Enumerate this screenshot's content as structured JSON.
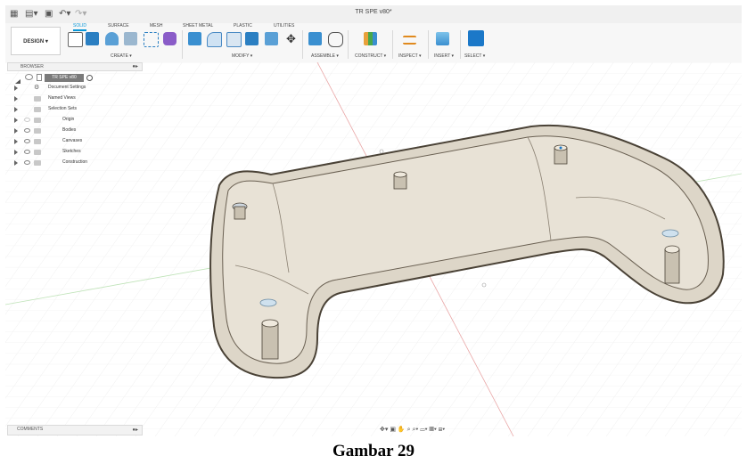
{
  "window": {
    "title": "TR SPE v80*"
  },
  "workspace": {
    "button_label": "DESIGN ▾"
  },
  "tabs": [
    {
      "label": "SOLID",
      "active": true
    },
    {
      "label": "SURFACE"
    },
    {
      "label": "MESH"
    },
    {
      "label": "SHEET METAL"
    },
    {
      "label": "PLASTIC"
    },
    {
      "label": "UTILITIES"
    }
  ],
  "groups": {
    "create": "CREATE ▾",
    "modify": "MODIFY ▾",
    "assemble": "ASSEMBLE ▾",
    "construct": "CONSTRUCT ▾",
    "inspect": "INSPECT ▾",
    "insert": "INSERT ▾",
    "select": "SELECT ▾"
  },
  "browser": {
    "title": "BROWSER",
    "root": "TR SPE v80",
    "items": [
      {
        "label": "Document Settings"
      },
      {
        "label": "Named Views"
      },
      {
        "label": "Selection Sets"
      },
      {
        "label": "Origin"
      },
      {
        "label": "Bodies"
      },
      {
        "label": "Canvases"
      },
      {
        "label": "Sketches"
      },
      {
        "label": "Construction"
      }
    ]
  },
  "comments": {
    "label": "COMMENTS"
  },
  "caption": "Gambar 29",
  "colors": {
    "accent": "#0696d7",
    "model": "#ddd6c8",
    "model_edge": "#4a4236"
  }
}
